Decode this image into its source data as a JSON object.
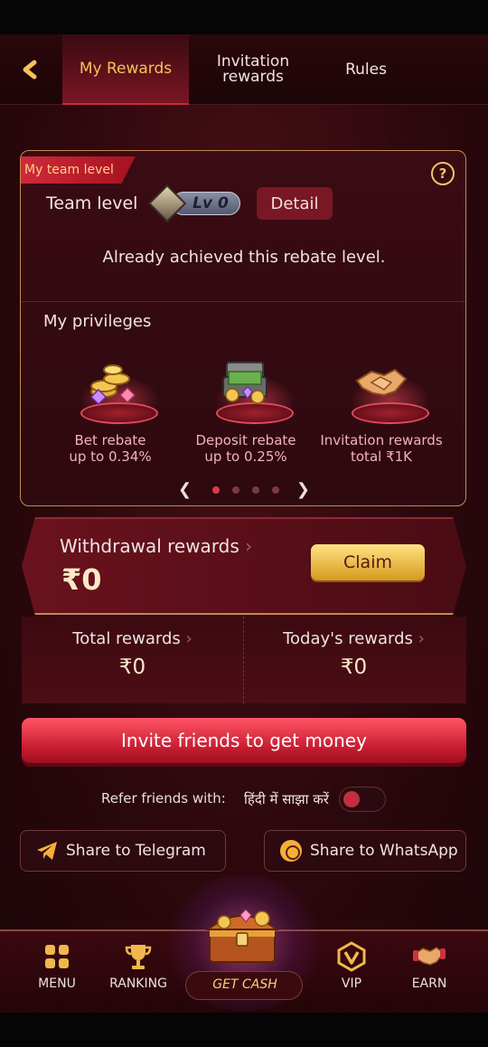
{
  "header": {
    "tabs": [
      {
        "label": "My Rewards",
        "active": true
      },
      {
        "label": "Invitation rewards",
        "active": false
      },
      {
        "label": "Rules",
        "active": false
      }
    ],
    "accent_color": "#f4c25a"
  },
  "team": {
    "ribbon": "My team level",
    "team_level_label": "Team level",
    "level_badge": "Lv 0",
    "detail_label": "Detail",
    "achieved_text": "Already achieved this rebate level.",
    "privileges_title": "My privileges",
    "privileges": [
      {
        "line1": "Bet rebate",
        "line2": "up to 0.34%",
        "icon": "coins-gems-icon"
      },
      {
        "line1": "Deposit rebate",
        "line2": "up to 0.25%",
        "icon": "money-chest-icon"
      },
      {
        "line1": "Invitation rewards",
        "line2": "total ₹1K",
        "icon": "handshake-icon"
      }
    ],
    "carousel_pages": 4,
    "carousel_active": 0
  },
  "withdrawal": {
    "title": "Withdrawal rewards",
    "amount": "₹0",
    "claim_label": "Claim"
  },
  "totals": {
    "total_label": "Total rewards",
    "total_value": "₹0",
    "today_label": "Today's rewards",
    "today_value": "₹0"
  },
  "invite": {
    "label": "Invite friends to get money"
  },
  "refer": {
    "label": "Refer friends with:",
    "language": "हिंदी में साझा करें",
    "toggle_on": false
  },
  "share": {
    "telegram": "Share to Telegram",
    "whatsapp": "Share to WhatsApp"
  },
  "nav": {
    "menu": "MENU",
    "ranking": "RANKING",
    "getcash": "GET CASH",
    "vip": "VIP",
    "earn": "EARN"
  }
}
